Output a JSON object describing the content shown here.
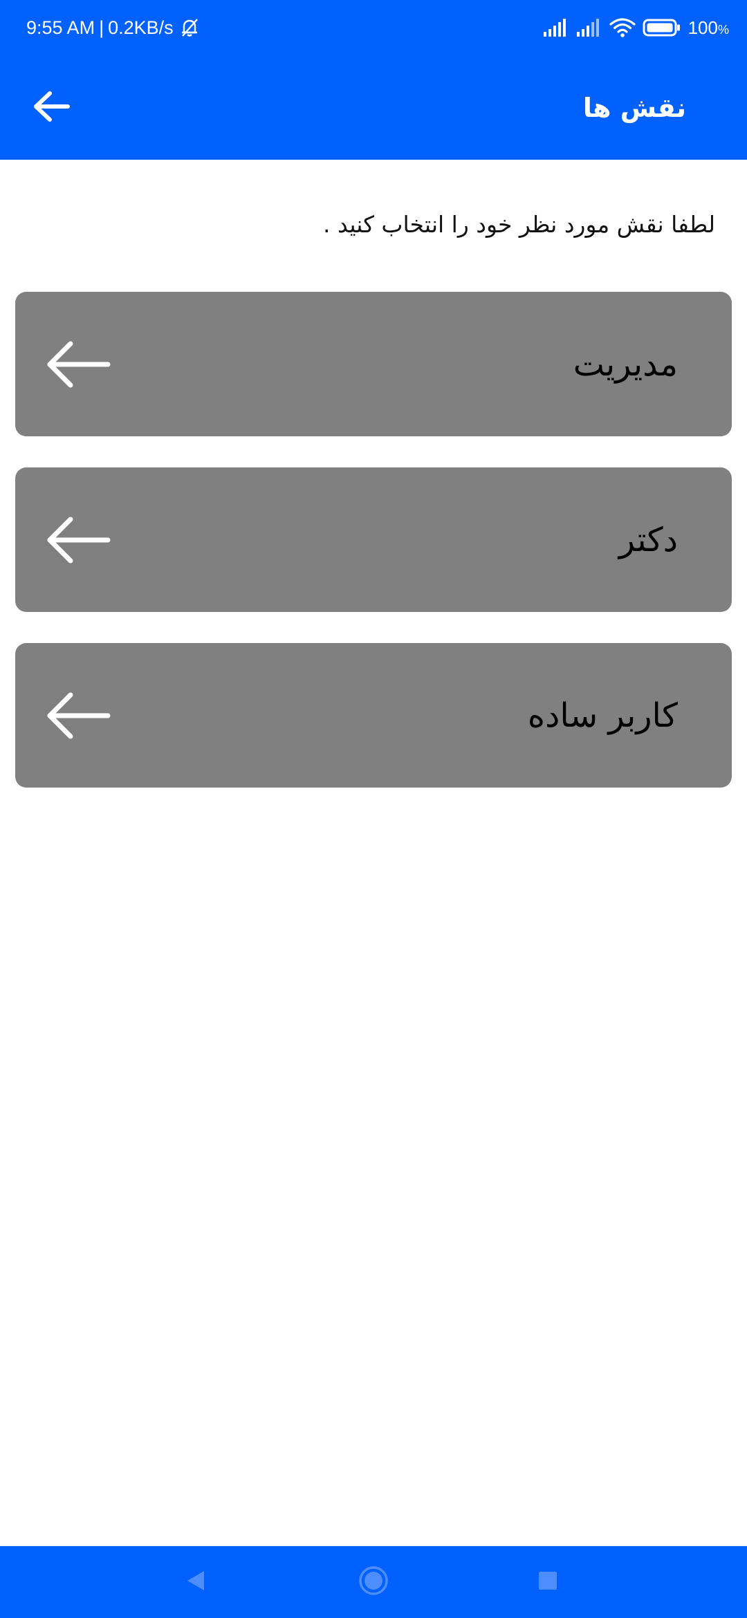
{
  "status_bar": {
    "time": "9:55 AM",
    "separator": "|",
    "net_speed": "0.2KB/s",
    "battery_level": "100",
    "battery_unit": "%",
    "icons": [
      "muted-bell-icon",
      "signal-icon",
      "signal-icon",
      "wifi-icon",
      "battery-icon"
    ]
  },
  "app_bar": {
    "title": "نقش ها",
    "back_icon": "arrow-left-icon"
  },
  "instruction": "لطفا نقش مورد نظر خود را انتخاب کنید .",
  "roles": [
    {
      "label": "مدیریت",
      "icon": "arrow-left-icon"
    },
    {
      "label": "دکتر",
      "icon": "arrow-left-icon"
    },
    {
      "label": "کاربر ساده",
      "icon": "arrow-left-icon"
    }
  ],
  "nav_bar": {
    "buttons": [
      "back-triangle-icon",
      "home-circle-icon",
      "recents-square-icon"
    ]
  },
  "colors": {
    "primary": "#0061fe",
    "card": "#808080",
    "background": "#ffffff",
    "text": "#000000",
    "nav_icon": "#4d8dfe"
  }
}
